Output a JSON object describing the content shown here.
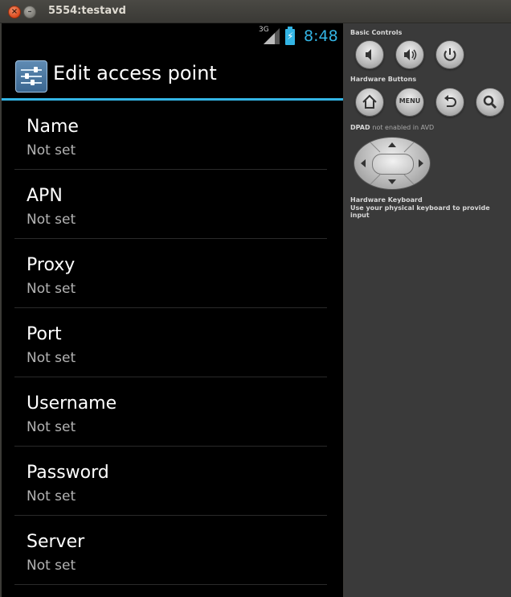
{
  "window": {
    "title": "5554:testavd"
  },
  "status_bar": {
    "network": "3G",
    "time": "8:48"
  },
  "action_bar": {
    "title": "Edit access point"
  },
  "preferences": [
    {
      "title": "Name",
      "summary": "Not set"
    },
    {
      "title": "APN",
      "summary": "Not set"
    },
    {
      "title": "Proxy",
      "summary": "Not set"
    },
    {
      "title": "Port",
      "summary": "Not set"
    },
    {
      "title": "Username",
      "summary": "Not set"
    },
    {
      "title": "Password",
      "summary": "Not set"
    },
    {
      "title": "Server",
      "summary": "Not set"
    }
  ],
  "controls": {
    "basic_label": "Basic Controls",
    "hardware_label": "Hardware Buttons",
    "menu_label": "MENU",
    "dpad_label": "DPAD",
    "dpad_note": "not enabled in AVD",
    "keyboard_label": "Hardware Keyboard",
    "keyboard_note": "Use your physical keyboard to provide input"
  },
  "colors": {
    "accent": "#33b5e5",
    "screen_bg": "#000000",
    "panel_bg": "#3a3a3a"
  }
}
